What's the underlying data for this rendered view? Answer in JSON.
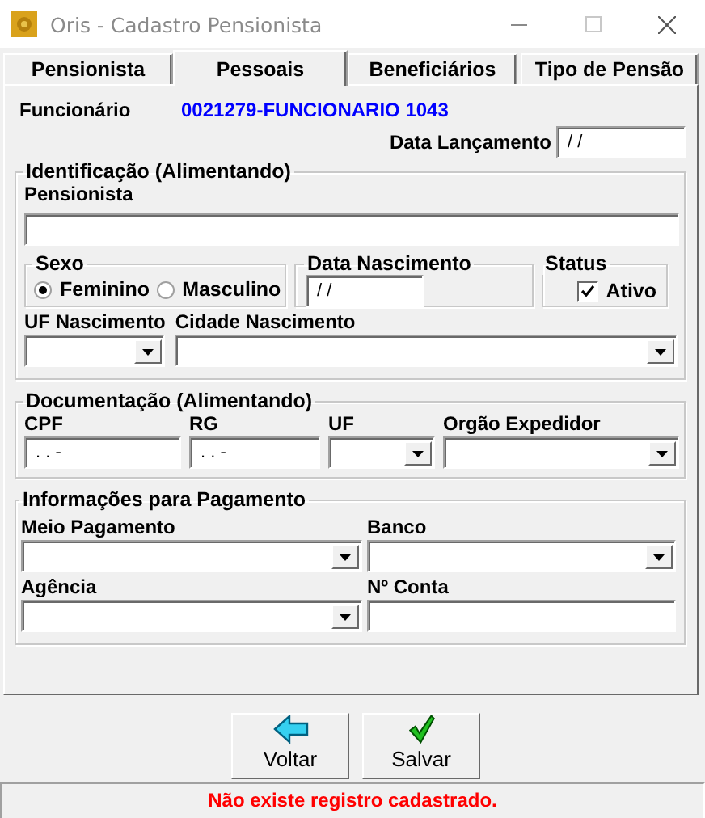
{
  "window": {
    "title": "Oris - Cadastro Pensionista"
  },
  "tabs": [
    {
      "label": "Pensionista",
      "selected": false
    },
    {
      "label": "Pessoais",
      "selected": true
    },
    {
      "label": "Beneficiários",
      "selected": false
    },
    {
      "label": "Tipo de Pensão",
      "selected": false
    }
  ],
  "funcionario": {
    "label": "Funcionário",
    "value": "0021279-FUNCIONARIO 1043"
  },
  "data_lancamento": {
    "label": "Data Lançamento",
    "value": "/ /"
  },
  "identificacao": {
    "title": "Identificação (Alimentando)",
    "pensionista": {
      "label": "Pensionista"
    },
    "sexo": {
      "title": "Sexo",
      "options": [
        {
          "label": "Feminino",
          "selected": true
        },
        {
          "label": "Masculino",
          "selected": false
        }
      ]
    },
    "data_nascimento": {
      "title": "Data Nascimento",
      "value": "/ /"
    },
    "status": {
      "title": "Status",
      "checkbox": {
        "label": "Ativo",
        "checked": true
      }
    },
    "uf_nascimento": {
      "label": "UF Nascimento"
    },
    "cidade_nascimento": {
      "label": "Cidade Nascimento"
    }
  },
  "documentacao": {
    "title": "Documentação (Alimentando)",
    "fields": [
      {
        "kind": "text",
        "label": "CPF",
        "value": ". . -"
      },
      {
        "kind": "text",
        "label": "RG",
        "value": ". . -"
      },
      {
        "kind": "combo",
        "label": "UF"
      },
      {
        "kind": "combo",
        "label": "Orgão Expedidor"
      }
    ]
  },
  "pagamento": {
    "title": "Informações para Pagamento",
    "fields": [
      {
        "kind": "combo",
        "label": "Meio Pagamento"
      },
      {
        "kind": "combo",
        "label": "Banco"
      },
      {
        "kind": "combo",
        "label": "Agência"
      },
      {
        "kind": "text",
        "label": "Nº Conta"
      }
    ]
  },
  "buttons": [
    {
      "kind": "back",
      "label": "Voltar"
    },
    {
      "kind": "save",
      "label": "Salvar"
    }
  ],
  "status_bar": {
    "message": "Não existe registro cadastrado."
  }
}
